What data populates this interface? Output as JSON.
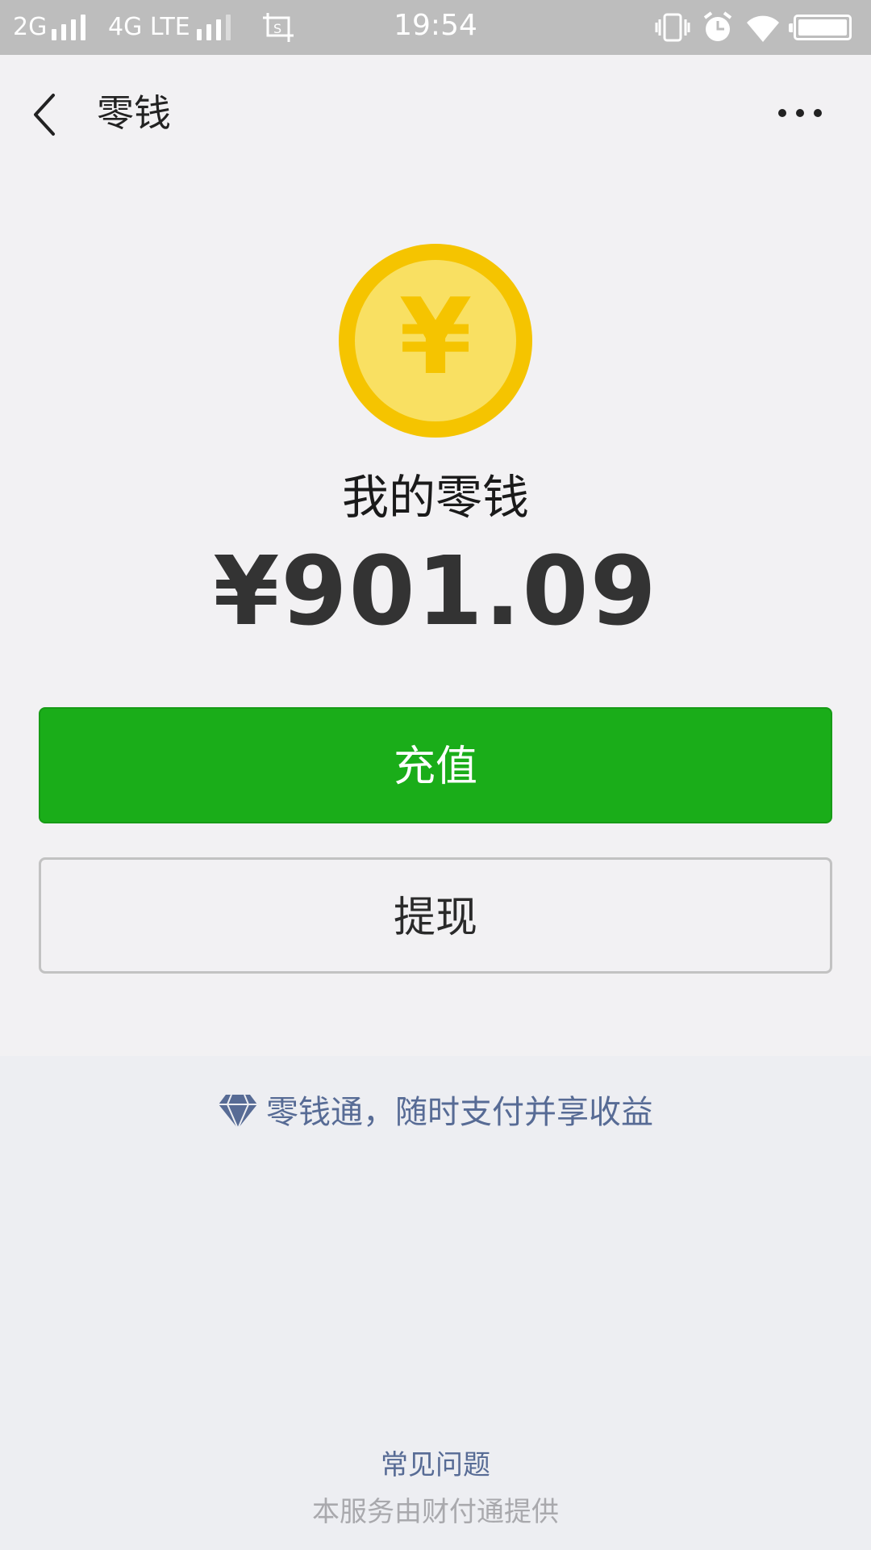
{
  "status_bar": {
    "network_1": "2G",
    "network_2": "4G LTE",
    "time": "19:54"
  },
  "nav": {
    "title": "零钱"
  },
  "balance": {
    "label": "我的零钱",
    "amount": "¥901.09",
    "coin_symbol": "¥"
  },
  "actions": {
    "recharge_label": "充值",
    "withdraw_label": "提现"
  },
  "promo": {
    "text": "零钱通，随时支付并享收益"
  },
  "footer": {
    "faq": "常见问题",
    "provider": "本服务由财付通提供"
  },
  "colors": {
    "accent_green": "#1aad19",
    "link_blue": "#576b95",
    "coin_outer": "#f5c400",
    "coin_inner": "#f9e062"
  },
  "icons": [
    "back-arrow-icon",
    "more-icon",
    "coin-yen-icon",
    "diamond-icon",
    "vibrate-icon",
    "alarm-icon",
    "wifi-icon",
    "battery-icon",
    "screenshot-icon"
  ]
}
